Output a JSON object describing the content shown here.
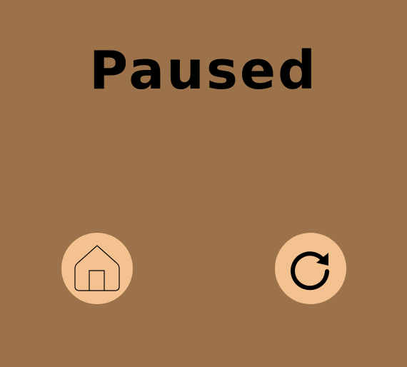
{
  "pause_menu": {
    "title": "Paused",
    "home_button": {
      "icon": "home-icon"
    },
    "restart_button": {
      "icon": "restart-icon"
    }
  },
  "colors": {
    "background": "#9b7249",
    "button_fill": "#f4c291",
    "text": "#000000"
  }
}
